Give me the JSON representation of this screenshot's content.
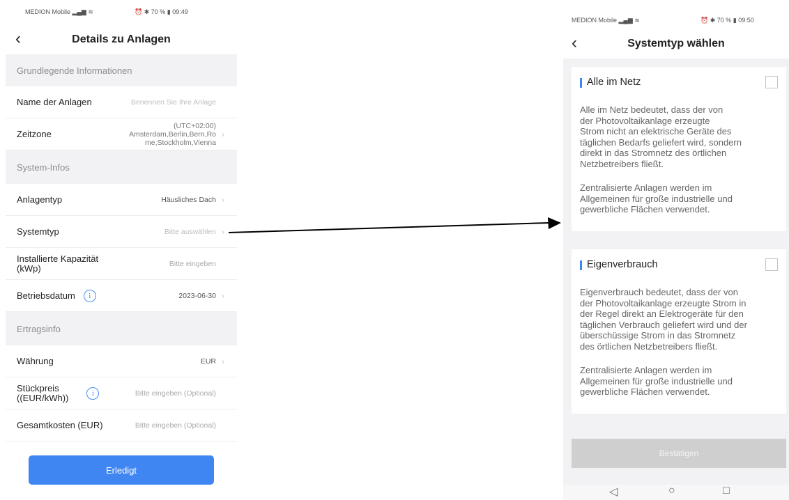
{
  "left": {
    "status": {
      "carrier": "MEDION Mobile",
      "battery": "70 %",
      "time": "09:49"
    },
    "title": "Details zu Anlagen",
    "sections": {
      "basic": "Grundlegende Informationen",
      "system": "System-Infos",
      "yield": "Ertragsinfo"
    },
    "rows": {
      "name": {
        "label": "Name der Anlagen",
        "value": "Benennen Sie Ihre Anlage"
      },
      "timezone": {
        "label": "Zeitzone",
        "value_line1": "(UTC+02:00)",
        "value_line2": "Amsterdam,Berlin,Bern,Ro",
        "value_line3": "me,Stockholm,Vienna"
      },
      "plant_type": {
        "label": "Anlagentyp",
        "value": "Häusliches Dach"
      },
      "system_type": {
        "label": "Systemtyp",
        "value": "Bitte auswählen"
      },
      "capacity": {
        "label_line1": "Installierte Kapazität",
        "label_line2": "(kWp)",
        "value": "Bitte eingeben"
      },
      "operating_date": {
        "label": "Betriebsdatum",
        "value": "2023-06-30"
      },
      "currency": {
        "label": "Währung",
        "value": "EUR"
      },
      "unit_price": {
        "label_line1": "Stückpreis",
        "label_line2": "((EUR/kWh))",
        "value": "Bitte eingeben (Optional)"
      },
      "total_cost": {
        "label": "Gesamtkosten (EUR)",
        "value": "Bitte eingeben (Optional)"
      }
    },
    "done_button": "Erledigt"
  },
  "right": {
    "status": {
      "carrier": "MEDION Mobile",
      "battery": "70 %",
      "time": "09:50"
    },
    "title": "Systemtyp wählen",
    "options": [
      {
        "title": "Alle im Netz",
        "checked": false,
        "desc1": [
          "Alle im Netz bedeutet, dass der von",
          "der Photovoltaikanlage erzeugte",
          "Strom nicht an elektrische Geräte des",
          "täglichen Bedarfs geliefert wird, sondern",
          "direkt in das Stromnetz des örtlichen",
          "Netzbetreibers fließt."
        ],
        "desc2": [
          "Zentralisierte Anlagen werden im",
          "Allgemeinen für große industrielle und",
          "gewerbliche Flächen verwendet."
        ]
      },
      {
        "title": "Eigenverbrauch",
        "checked": false,
        "desc1": [
          "Eigenverbrauch bedeutet, dass der von",
          "der Photovoltaikanlage erzeugte Strom in",
          "der Regel direkt an Elektrogeräte für den",
          "täglichen Verbrauch geliefert wird und der",
          "überschüssige Strom in das Stromnetz",
          "des örtlichen Netzbetreibers fließt."
        ],
        "desc2": [
          "Zentralisierte Anlagen werden im",
          "Allgemeinen für große industrielle und",
          "gewerbliche Flächen verwendet."
        ]
      }
    ],
    "confirm_button": "Bestätigen"
  },
  "icons": {
    "back": "chevron-left-icon",
    "chevron": "chevron-right-icon",
    "info": "info-icon",
    "nav_back": "triangle-back-icon",
    "nav_home": "circle-home-icon",
    "nav_recent": "square-recent-icon"
  },
  "colors": {
    "accent": "#3f86f2",
    "disabled": "#cfcfcf",
    "section_bg": "#f2f2f4"
  }
}
